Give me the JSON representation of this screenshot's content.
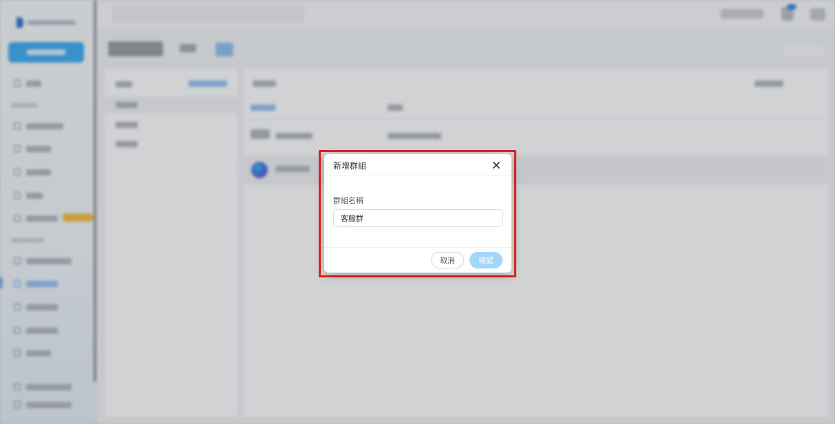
{
  "dialog": {
    "title": "新增群組",
    "field_label": "群組名稱",
    "field_value": "客服群",
    "cancel_label": "取消",
    "confirm_label": "確認",
    "close_icon": "close-icon"
  },
  "colors": {
    "highlight": "#e02020",
    "confirm_button": "#a3d7f8",
    "accent": "#2f7fe0"
  }
}
